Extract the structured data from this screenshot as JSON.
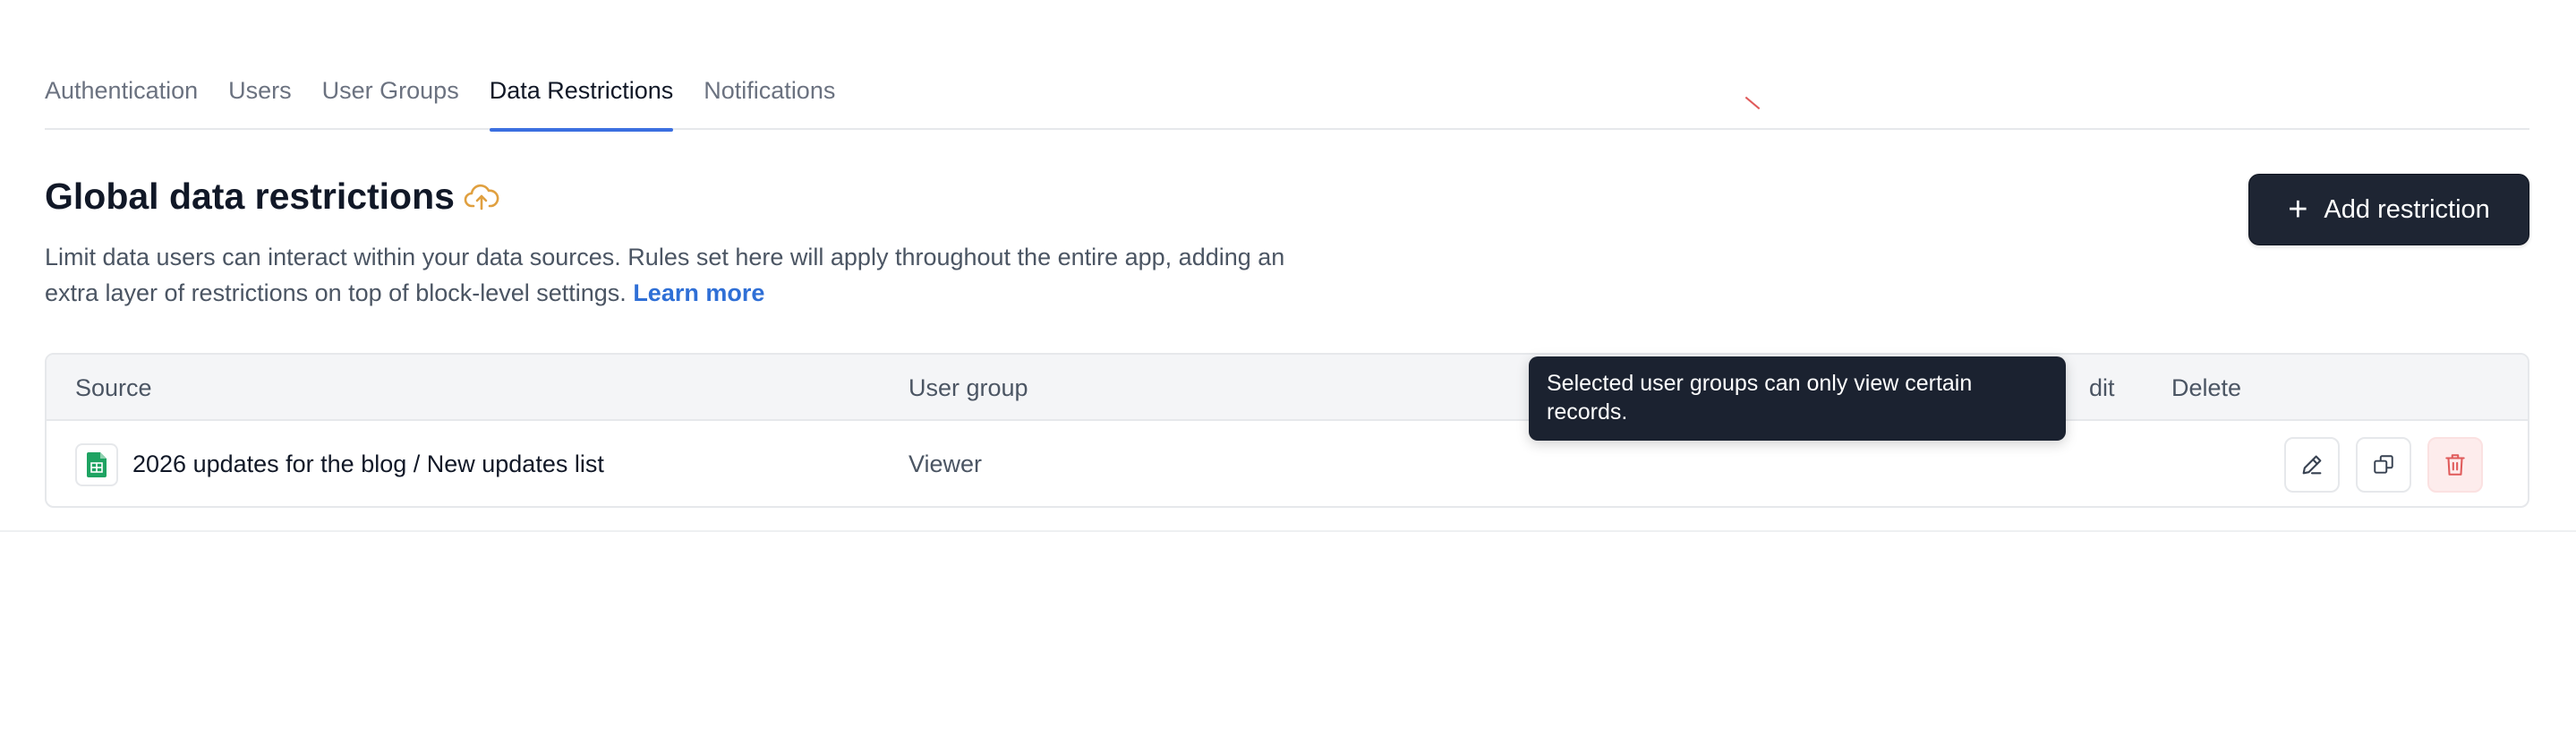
{
  "tabs": [
    {
      "label": "Authentication",
      "active": false
    },
    {
      "label": "Users",
      "active": false
    },
    {
      "label": "User Groups",
      "active": false
    },
    {
      "label": "Data Restrictions",
      "active": true
    },
    {
      "label": "Notifications",
      "active": false
    }
  ],
  "header": {
    "title": "Global data restrictions",
    "title_icon": "cloud-upload-icon",
    "description": "Limit data users can interact within your data sources. Rules set here will apply throughout the entire app, adding an extra layer of restrictions on top of block-level settings.",
    "learn_more": "Learn more",
    "add_button": {
      "label": "Add restriction",
      "icon": "plus-icon"
    }
  },
  "table": {
    "columns": {
      "source": "Source",
      "user_group": "User group",
      "edit": "dit",
      "delete": "Delete"
    },
    "rows": [
      {
        "source_icon": "google-sheets-icon",
        "source": "2026 updates for the blog / New updates list",
        "user_group": "Viewer"
      }
    ]
  },
  "tooltip": {
    "text": "Selected user groups can only view certain records."
  },
  "colors": {
    "accent": "#3b6fe0",
    "primary_button": "#1e2533",
    "danger": "#e05a5a",
    "link": "#2f6fd6",
    "cloud_icon": "#e0a040",
    "sheets_green": "#1ea362"
  }
}
